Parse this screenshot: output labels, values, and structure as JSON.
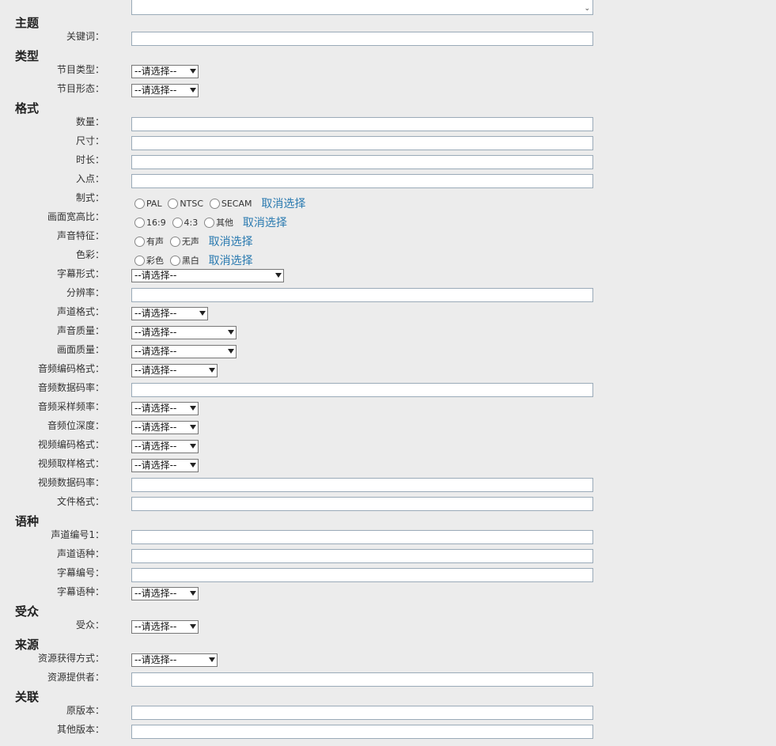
{
  "sections": {
    "subject": "主题",
    "type": "类型",
    "format": "格式",
    "language": "语种",
    "audience": "受众",
    "source": "来源",
    "relation": "关联"
  },
  "labels": {
    "keyword": "关键词：",
    "program_type": "节目类型：",
    "program_form": "节目形态：",
    "quantity": "数量：",
    "size": "尺寸：",
    "duration": "时长：",
    "in_point": "入点：",
    "standard": "制式：",
    "aspect_ratio": "画面宽高比：",
    "sound_feature": "声音特征：",
    "color": "色彩：",
    "subtitle_form": "字幕形式：",
    "resolution": "分辨率：",
    "channel_format": "声道格式：",
    "sound_quality": "声音质量：",
    "picture_quality": "画面质量：",
    "audio_codec": "音频编码格式：",
    "audio_bitrate": "音频数据码率：",
    "audio_sample_rate": "音频采样频率：",
    "audio_bit_depth": "音频位深度：",
    "video_codec": "视频编码格式：",
    "video_sampling": "视频取样格式：",
    "video_bitrate": "视频数据码率：",
    "file_format": "文件格式：",
    "channel_no": "声道编号1：",
    "channel_language": "声道语种：",
    "subtitle_no": "字幕编号：",
    "subtitle_language": "字幕语种：",
    "audience": "受众：",
    "acquisition": "资源获得方式：",
    "provider": "资源提供者：",
    "original_version": "原版本：",
    "other_version": "其他版本："
  },
  "select_placeholder": "--请选择--",
  "cancel_label": "取消选择",
  "radios": {
    "standard": [
      "PAL",
      "NTSC",
      "SECAM"
    ],
    "aspect_ratio": [
      "16:9",
      "4:3",
      "其他"
    ],
    "sound_feature": [
      "有声",
      "无声"
    ],
    "color": [
      "彩色",
      "黑白"
    ]
  }
}
